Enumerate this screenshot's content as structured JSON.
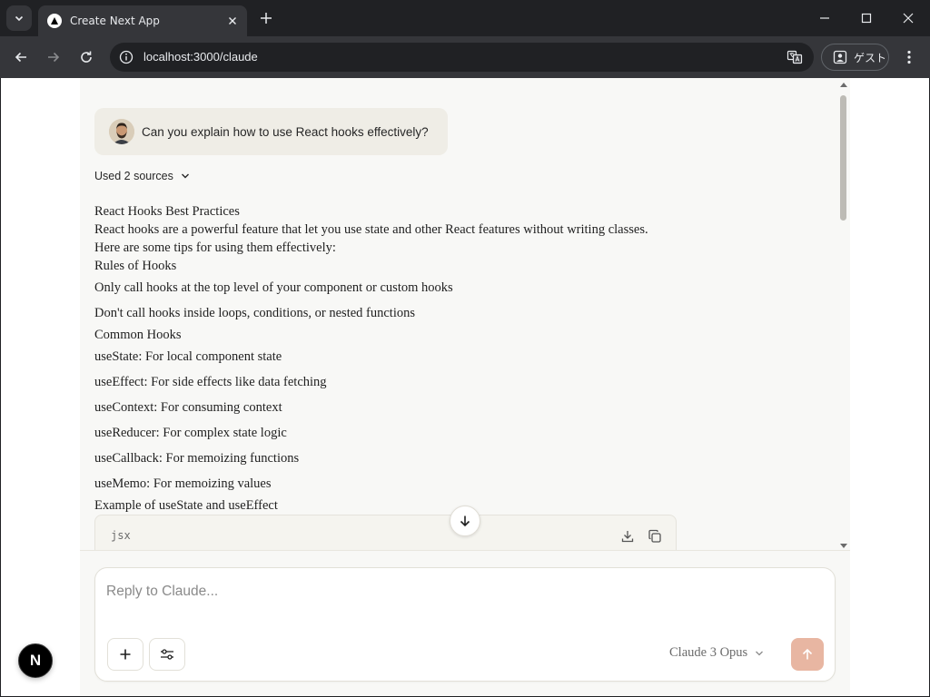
{
  "browser": {
    "tab_title": "Create Next App",
    "url": "localhost:3000/claude",
    "profile_label": "ゲスト"
  },
  "chat": {
    "user_message": "Can you explain how to use React hooks effectively?",
    "sources_label": "Used 2 sources",
    "answer": {
      "title": "React Hooks Best Practices",
      "intro": "React hooks are a powerful feature that let you use state and other React features without writing classes. Here are some tips for using them effectively:",
      "rules_heading": "Rules of Hooks",
      "rules": [
        "Only call hooks at the top level of your component or custom hooks",
        "Don't call hooks inside loops, conditions, or nested functions"
      ],
      "common_heading": "Common Hooks",
      "common": [
        "useState: For local component state",
        "useEffect: For side effects like data fetching",
        "useContext: For consuming context",
        "useReducer: For complex state logic",
        "useCallback: For memoizing functions",
        "useMemo: For memoizing values"
      ],
      "example_heading": "Example of useState and useEffect"
    },
    "code_block": {
      "language": "jsx"
    }
  },
  "composer": {
    "placeholder": "Reply to Claude...",
    "model": "Claude 3 Opus"
  },
  "next_badge": "N",
  "colors": {
    "chat_background": "#f8f8f6",
    "user_bubble": "#efede6",
    "send_button": "#e8b6a2"
  }
}
